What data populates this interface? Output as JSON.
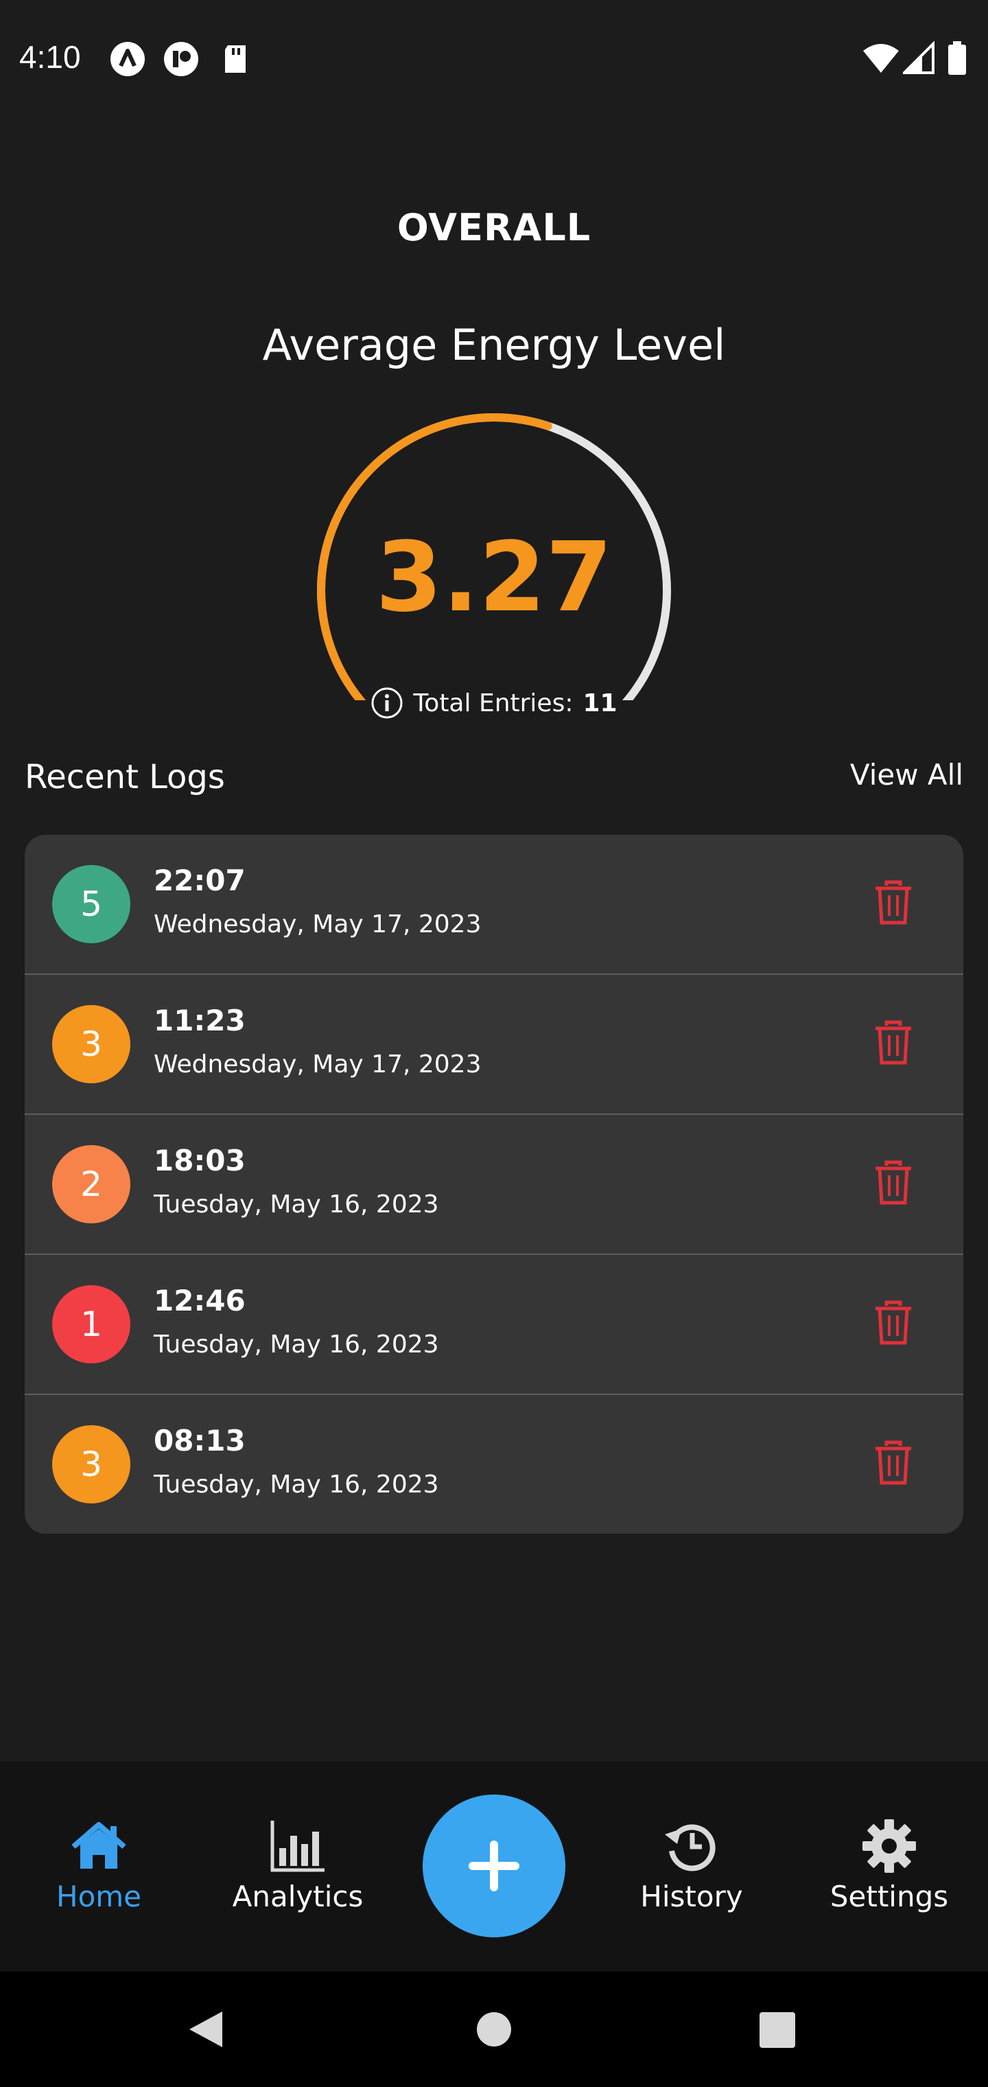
{
  "status_bar": {
    "time": "4:10",
    "left_icons": [
      "autofill-icon",
      "notification-icon",
      "sd-card-icon"
    ],
    "right_icons": [
      "wifi-icon",
      "signal-icon",
      "battery-icon"
    ]
  },
  "header": {
    "section_label": "OVERALL",
    "title": "Average Energy Level"
  },
  "gauge": {
    "value": "3.27",
    "min": 1,
    "max": 5,
    "fill_color": "#f5961f",
    "track_color": "#e6e6e6",
    "total_entries_label": "Total Entries:",
    "total_entries_value": "11",
    "info_icon": "info-icon"
  },
  "recent_logs": {
    "title": "Recent Logs",
    "view_all_label": "View All",
    "items": [
      {
        "level": "5",
        "color": "#3ea885",
        "time": "22:07",
        "date": "Wednesday, May 17, 2023"
      },
      {
        "level": "3",
        "color": "#f5961f",
        "time": "11:23",
        "date": "Wednesday, May 17, 2023"
      },
      {
        "level": "2",
        "color": "#f7834a",
        "time": "18:03",
        "date": "Tuesday, May 16, 2023"
      },
      {
        "level": "1",
        "color": "#f23f45",
        "time": "12:46",
        "date": "Tuesday, May 16, 2023"
      },
      {
        "level": "3",
        "color": "#f5961f",
        "time": "08:13",
        "date": "Tuesday, May 16, 2023"
      }
    ],
    "delete_color": "#e0313a"
  },
  "bottom_nav": {
    "items": [
      {
        "label": "Home",
        "icon": "home-icon",
        "active": true
      },
      {
        "label": "Analytics",
        "icon": "bar-chart-icon",
        "active": false
      },
      {
        "label": "History",
        "icon": "history-icon",
        "active": false
      },
      {
        "label": "Settings",
        "icon": "gear-icon",
        "active": false
      }
    ],
    "fab_icon": "plus-icon",
    "active_color": "#3aa0ee",
    "fab_color": "#3aa6ef"
  },
  "system_nav": {
    "icons": [
      "back-icon",
      "home-circle-icon",
      "recents-icon"
    ]
  }
}
